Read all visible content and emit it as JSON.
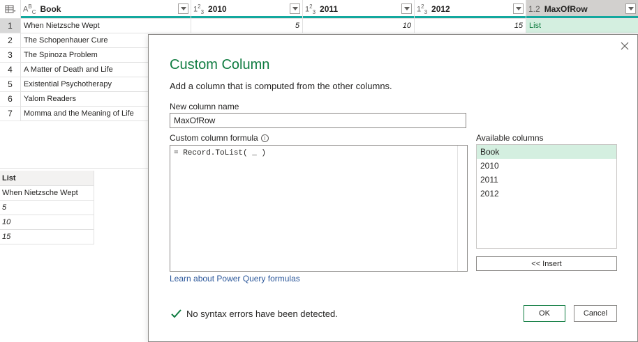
{
  "columns": [
    {
      "type_icon": "ABC",
      "name": "Book"
    },
    {
      "type_icon": "123",
      "name": "2010"
    },
    {
      "type_icon": "123",
      "name": "2011"
    },
    {
      "type_icon": "123",
      "name": "2012"
    },
    {
      "type_icon": "1.2",
      "name": "MaxOfRow"
    }
  ],
  "rows": [
    {
      "num": "1",
      "book": "When Nietzsche Wept",
      "v2010": "5",
      "v2011": "10",
      "v2012": "15",
      "max": "List"
    },
    {
      "num": "2",
      "book": "The Schopenhauer Cure"
    },
    {
      "num": "3",
      "book": "The Spinoza Problem"
    },
    {
      "num": "4",
      "book": "A Matter of Death and Life"
    },
    {
      "num": "5",
      "book": "Existential Psychotherapy"
    },
    {
      "num": "6",
      "book": "Yalom Readers"
    },
    {
      "num": "7",
      "book": "Momma and the Meaning of Life"
    }
  ],
  "preview": {
    "header": "List",
    "items": [
      "When Nietzsche Wept",
      "5",
      "10",
      "15"
    ]
  },
  "dialog": {
    "title": "Custom Column",
    "description": "Add a column that is computed from the other columns.",
    "new_column_label": "New column name",
    "new_column_value": "MaxOfRow",
    "formula_label": "Custom column formula",
    "formula_value": "= Record.ToList( _ )",
    "available_label": "Available columns",
    "available_columns": [
      "Book",
      "2010",
      "2011",
      "2012"
    ],
    "insert_label": "<< Insert",
    "learn_link": "Learn about Power Query formulas",
    "status": "No syntax errors have been detected.",
    "ok_label": "OK",
    "cancel_label": "Cancel"
  },
  "colors": {
    "accent": "#107c41",
    "quality_bar": "#13a89e",
    "selection": "#d4efe0",
    "link": "#2b579a"
  }
}
